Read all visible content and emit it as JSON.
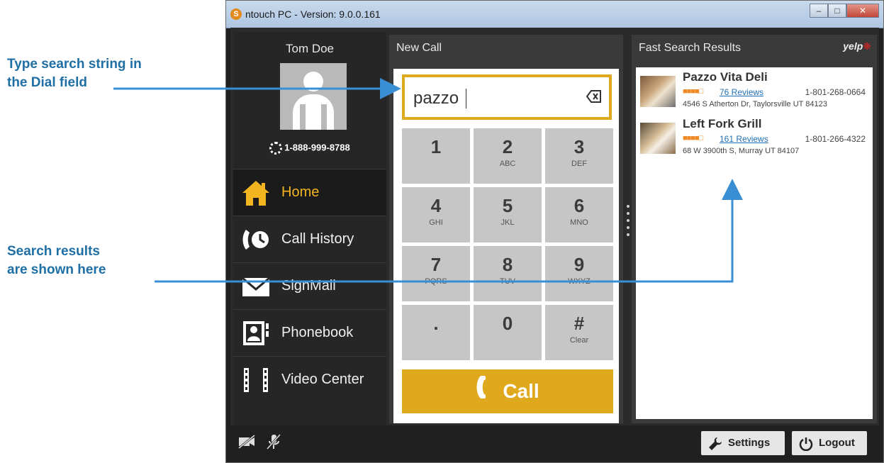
{
  "callouts": {
    "dial_line1": "Type search string in",
    "dial_line2": "the Dial field",
    "results_line1": "Search results",
    "results_line2": "are shown here"
  },
  "window": {
    "title": "ntouch PC  -  Version: 9.0.0.161",
    "app_icon_letter": "S"
  },
  "sidebar": {
    "user_name": "Tom Doe",
    "phone_number": "1-888-999-8788",
    "items": [
      {
        "label": "Home",
        "icon": "home-icon",
        "active": true
      },
      {
        "label": "Call History",
        "icon": "call-history-icon"
      },
      {
        "label": "SignMail",
        "icon": "envelope-icon"
      },
      {
        "label": "Phonebook",
        "icon": "phonebook-icon"
      },
      {
        "label": "Video Center",
        "icon": "film-icon"
      }
    ]
  },
  "dial": {
    "header": "New Call",
    "input_value": "pazzo",
    "keys": [
      {
        "digit": "1",
        "letters": ""
      },
      {
        "digit": "2",
        "letters": "ABC"
      },
      {
        "digit": "3",
        "letters": "DEF"
      },
      {
        "digit": "4",
        "letters": "GHI"
      },
      {
        "digit": "5",
        "letters": "JKL"
      },
      {
        "digit": "6",
        "letters": "MNO"
      },
      {
        "digit": "7",
        "letters": "PQRS"
      },
      {
        "digit": "8",
        "letters": "TUV"
      },
      {
        "digit": "9",
        "letters": "WXYZ"
      },
      {
        "digit": ".",
        "letters": ""
      },
      {
        "digit": "0",
        "letters": ""
      },
      {
        "digit": "#",
        "letters": "Clear"
      }
    ],
    "call_label": "Call"
  },
  "results": {
    "header": "Fast Search Results",
    "provider": "yelp",
    "items": [
      {
        "name": "Pazzo Vita Deli",
        "reviews": "76 Reviews",
        "phone": "1-801-268-0664",
        "address": "4546 S Atherton Dr, Taylorsville UT 84123"
      },
      {
        "name": "Left Fork Grill",
        "reviews": "161 Reviews",
        "phone": "1-801-266-4322",
        "address": "68 W 3900th S, Murray UT 84107"
      }
    ]
  },
  "bottom": {
    "settings_label": "Settings",
    "logout_label": "Logout"
  },
  "colors": {
    "accent": "#e0a91d",
    "callout_text": "#1f6fa5",
    "callout_line": "#3a8fd4"
  }
}
